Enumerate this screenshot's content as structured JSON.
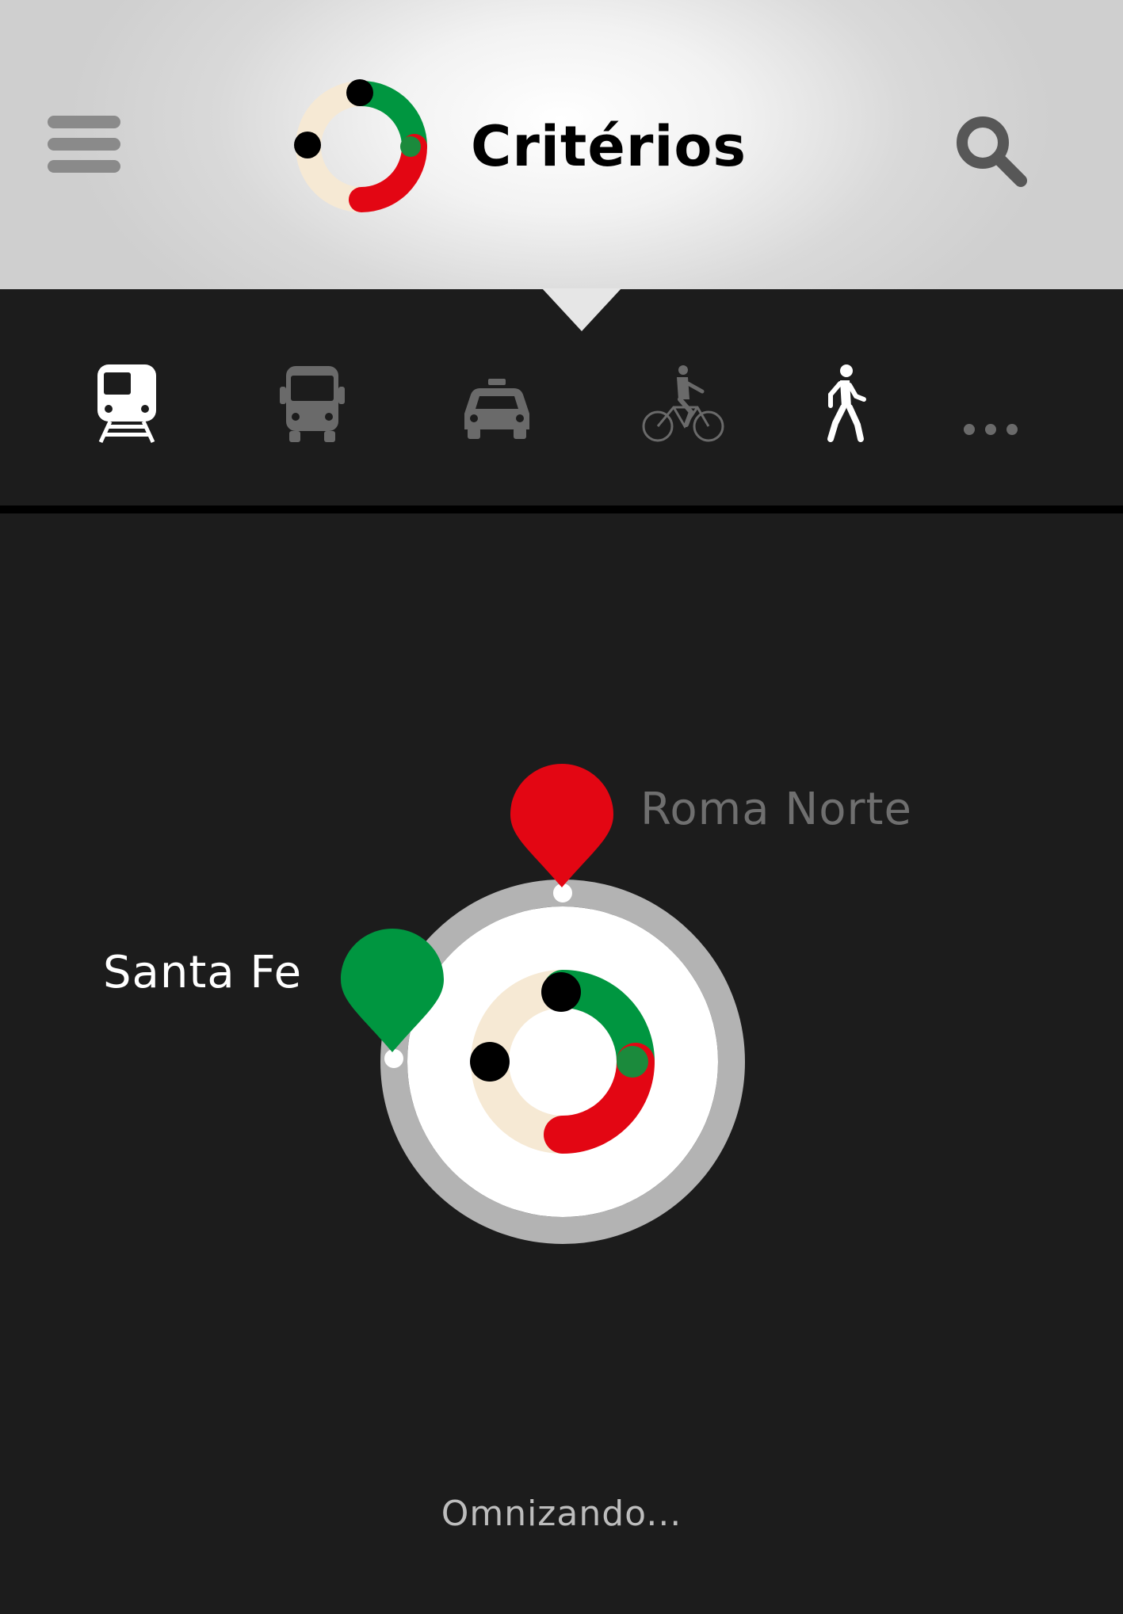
{
  "header": {
    "title": "Critérios",
    "menu_icon": "hamburger-menu-icon",
    "search_icon": "search-icon",
    "logo_icon": "omni-ring-logo"
  },
  "transport_modes": [
    {
      "name": "train",
      "icon": "train-icon",
      "selected": true,
      "color": "#ffffff"
    },
    {
      "name": "bus",
      "icon": "bus-icon",
      "selected": false,
      "color": "#6a6a6a"
    },
    {
      "name": "taxi",
      "icon": "taxi-icon",
      "selected": false,
      "color": "#6a6a6a"
    },
    {
      "name": "bike",
      "icon": "bicycle-icon",
      "selected": false,
      "color": "#6a6a6a"
    },
    {
      "name": "walk",
      "icon": "walking-person-icon",
      "selected": true,
      "color": "#ffffff"
    },
    {
      "name": "more",
      "icon": "more-dots-icon",
      "selected": false,
      "color": "#6a6a6a"
    }
  ],
  "route": {
    "origin": "Santa Fe",
    "destination": "Roma Norte",
    "origin_color": "#009640",
    "destination_color": "#e30613"
  },
  "status": "Omnizando...",
  "colors": {
    "green": "#009640",
    "red": "#e30613",
    "beige": "#f6e9d4",
    "ring_gray": "#b3b3b3",
    "background": "#1c1c1c"
  }
}
